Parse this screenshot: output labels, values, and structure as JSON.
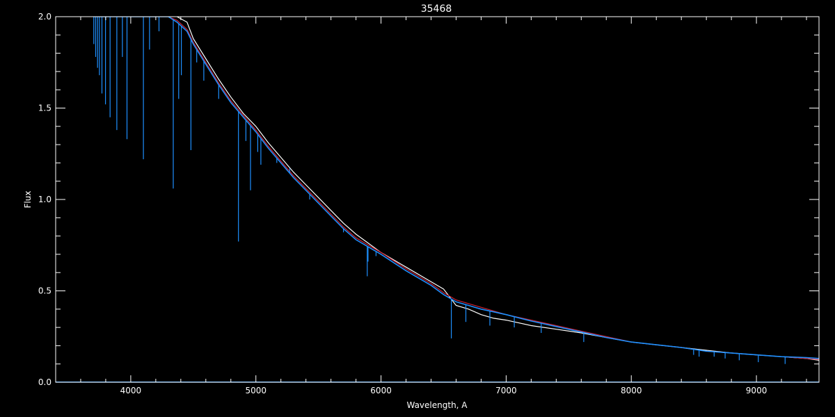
{
  "chart_data": {
    "type": "line",
    "title": "35468",
    "xlabel": "Wavelength, A",
    "ylabel": "Flux",
    "xlim": [
      3400,
      9500
    ],
    "ylim": [
      0,
      2.0
    ],
    "x_ticks": [
      4000,
      5000,
      6000,
      7000,
      8000,
      9000
    ],
    "x_tick_labels": [
      "4000",
      "5000",
      "6000",
      "7000",
      "8000",
      "9000"
    ],
    "y_ticks": [
      0.0,
      0.5,
      1.0,
      1.5,
      2.0
    ],
    "y_tick_labels": [
      "0.0",
      "0.5",
      "1.0",
      "1.5",
      "2.0"
    ],
    "grid": false,
    "colors": {
      "background": "#000000",
      "axes": "#ffffff",
      "observed": "#ffffff",
      "model": "#cc2233",
      "synthetic": "#1e90ff"
    },
    "series": [
      {
        "color": "#ffffff",
        "x": [
          4370,
          4450,
          4500,
          4600,
          4700,
          4800,
          4900,
          5000,
          5100,
          5200,
          5300,
          5400,
          5500,
          5600,
          5700,
          5800,
          5900,
          6000,
          6200,
          6400,
          6500,
          6600,
          6700,
          6800,
          6900,
          7000,
          7200,
          7400,
          7600,
          7800,
          8000,
          8200,
          8400,
          8600,
          8800,
          9000,
          9200,
          9400,
          9500
        ],
        "y": [
          2.0,
          1.97,
          1.88,
          1.77,
          1.66,
          1.56,
          1.47,
          1.4,
          1.31,
          1.23,
          1.15,
          1.08,
          1.01,
          0.94,
          0.87,
          0.81,
          0.76,
          0.71,
          0.63,
          0.55,
          0.51,
          0.42,
          0.4,
          0.37,
          0.35,
          0.34,
          0.31,
          0.29,
          0.27,
          0.245,
          0.22,
          0.205,
          0.19,
          0.175,
          0.16,
          0.15,
          0.14,
          0.13,
          0.12
        ]
      },
      {
        "color": "#cc2233",
        "x": [
          4300,
          4370,
          4450,
          4500,
          4600,
          4700,
          4800,
          4900,
          5000,
          5100,
          5200,
          5300,
          5400,
          5500,
          5600,
          5700,
          5800,
          5900,
          6000,
          6200,
          6400,
          6500,
          6600,
          6700,
          6800,
          6900,
          7000,
          7200,
          7400,
          7600,
          7800,
          8000,
          8200,
          8400,
          8600,
          8800,
          9000,
          9200,
          9400,
          9500
        ],
        "y": [
          2.0,
          1.98,
          1.93,
          1.86,
          1.75,
          1.64,
          1.54,
          1.46,
          1.38,
          1.29,
          1.21,
          1.13,
          1.06,
          0.99,
          0.92,
          0.85,
          0.79,
          0.75,
          0.71,
          0.62,
          0.54,
          0.49,
          0.45,
          0.43,
          0.41,
          0.39,
          0.37,
          0.34,
          0.31,
          0.28,
          0.25,
          0.22,
          0.205,
          0.19,
          0.17,
          0.16,
          0.15,
          0.14,
          0.13,
          0.125
        ]
      },
      {
        "color": "#1e90ff",
        "x": [
          3700,
          3800,
          3900,
          4000,
          4100,
          4200,
          4300,
          4370,
          4450,
          4500,
          4600,
          4700,
          4800,
          4900,
          5000,
          5100,
          5200,
          5300,
          5400,
          5500,
          5600,
          5700,
          5800,
          5900,
          6000,
          6200,
          6400,
          6500,
          6600,
          6700,
          6800,
          6900,
          7000,
          7200,
          7400,
          7600,
          7800,
          8000,
          8200,
          8400,
          8600,
          8800,
          9000,
          9200,
          9400,
          9500
        ],
        "y": [
          2.0,
          2.0,
          2.0,
          2.0,
          2.0,
          2.0,
          2.0,
          1.97,
          1.92,
          1.85,
          1.74,
          1.63,
          1.53,
          1.45,
          1.37,
          1.28,
          1.2,
          1.12,
          1.05,
          0.98,
          0.91,
          0.84,
          0.78,
          0.74,
          0.7,
          0.61,
          0.53,
          0.48,
          0.44,
          0.42,
          0.4,
          0.385,
          0.37,
          0.335,
          0.305,
          0.275,
          0.245,
          0.22,
          0.205,
          0.19,
          0.17,
          0.16,
          0.15,
          0.14,
          0.135,
          0.13
        ]
      }
    ],
    "absorption_lines": [
      {
        "x": 3705,
        "y_min": 1.85
      },
      {
        "x": 3720,
        "y_min": 1.78
      },
      {
        "x": 3735,
        "y_min": 1.72
      },
      {
        "x": 3750,
        "y_min": 1.68
      },
      {
        "x": 3770,
        "y_min": 1.58
      },
      {
        "x": 3798,
        "y_min": 1.52
      },
      {
        "x": 3835,
        "y_min": 1.45
      },
      {
        "x": 3889,
        "y_min": 1.38
      },
      {
        "x": 3933,
        "y_min": 1.78
      },
      {
        "x": 3970,
        "y_min": 1.33
      },
      {
        "x": 4101,
        "y_min": 1.22
      },
      {
        "x": 4150,
        "y_min": 1.82
      },
      {
        "x": 4226,
        "y_min": 1.92
      },
      {
        "x": 4340,
        "y_min": 1.06
      },
      {
        "x": 4383,
        "y_min": 1.55
      },
      {
        "x": 4404,
        "y_min": 1.68
      },
      {
        "x": 4481,
        "y_min": 1.27
      },
      {
        "x": 4527,
        "y_min": 1.75
      },
      {
        "x": 4584,
        "y_min": 1.65
      },
      {
        "x": 4703,
        "y_min": 1.55
      },
      {
        "x": 4861,
        "y_min": 0.77
      },
      {
        "x": 4920,
        "y_min": 1.32
      },
      {
        "x": 4957,
        "y_min": 1.05
      },
      {
        "x": 5015,
        "y_min": 1.26
      },
      {
        "x": 5040,
        "y_min": 1.19
      },
      {
        "x": 5167,
        "y_min": 1.2
      },
      {
        "x": 5270,
        "y_min": 1.17
      },
      {
        "x": 5328,
        "y_min": 1.1
      },
      {
        "x": 5430,
        "y_min": 1.0
      },
      {
        "x": 5700,
        "y_min": 0.82
      },
      {
        "x": 5890,
        "y_min": 0.58
      },
      {
        "x": 5896,
        "y_min": 0.66
      },
      {
        "x": 5960,
        "y_min": 0.69
      },
      {
        "x": 6562,
        "y_min": 0.24
      },
      {
        "x": 6678,
        "y_min": 0.33
      },
      {
        "x": 6870,
        "y_min": 0.31
      },
      {
        "x": 7065,
        "y_min": 0.3
      },
      {
        "x": 7280,
        "y_min": 0.27
      },
      {
        "x": 7620,
        "y_min": 0.22
      },
      {
        "x": 8498,
        "y_min": 0.15
      },
      {
        "x": 8542,
        "y_min": 0.14
      },
      {
        "x": 8662,
        "y_min": 0.14
      },
      {
        "x": 8750,
        "y_min": 0.13
      },
      {
        "x": 8863,
        "y_min": 0.12
      },
      {
        "x": 9015,
        "y_min": 0.11
      },
      {
        "x": 9229,
        "y_min": 0.1
      }
    ]
  }
}
